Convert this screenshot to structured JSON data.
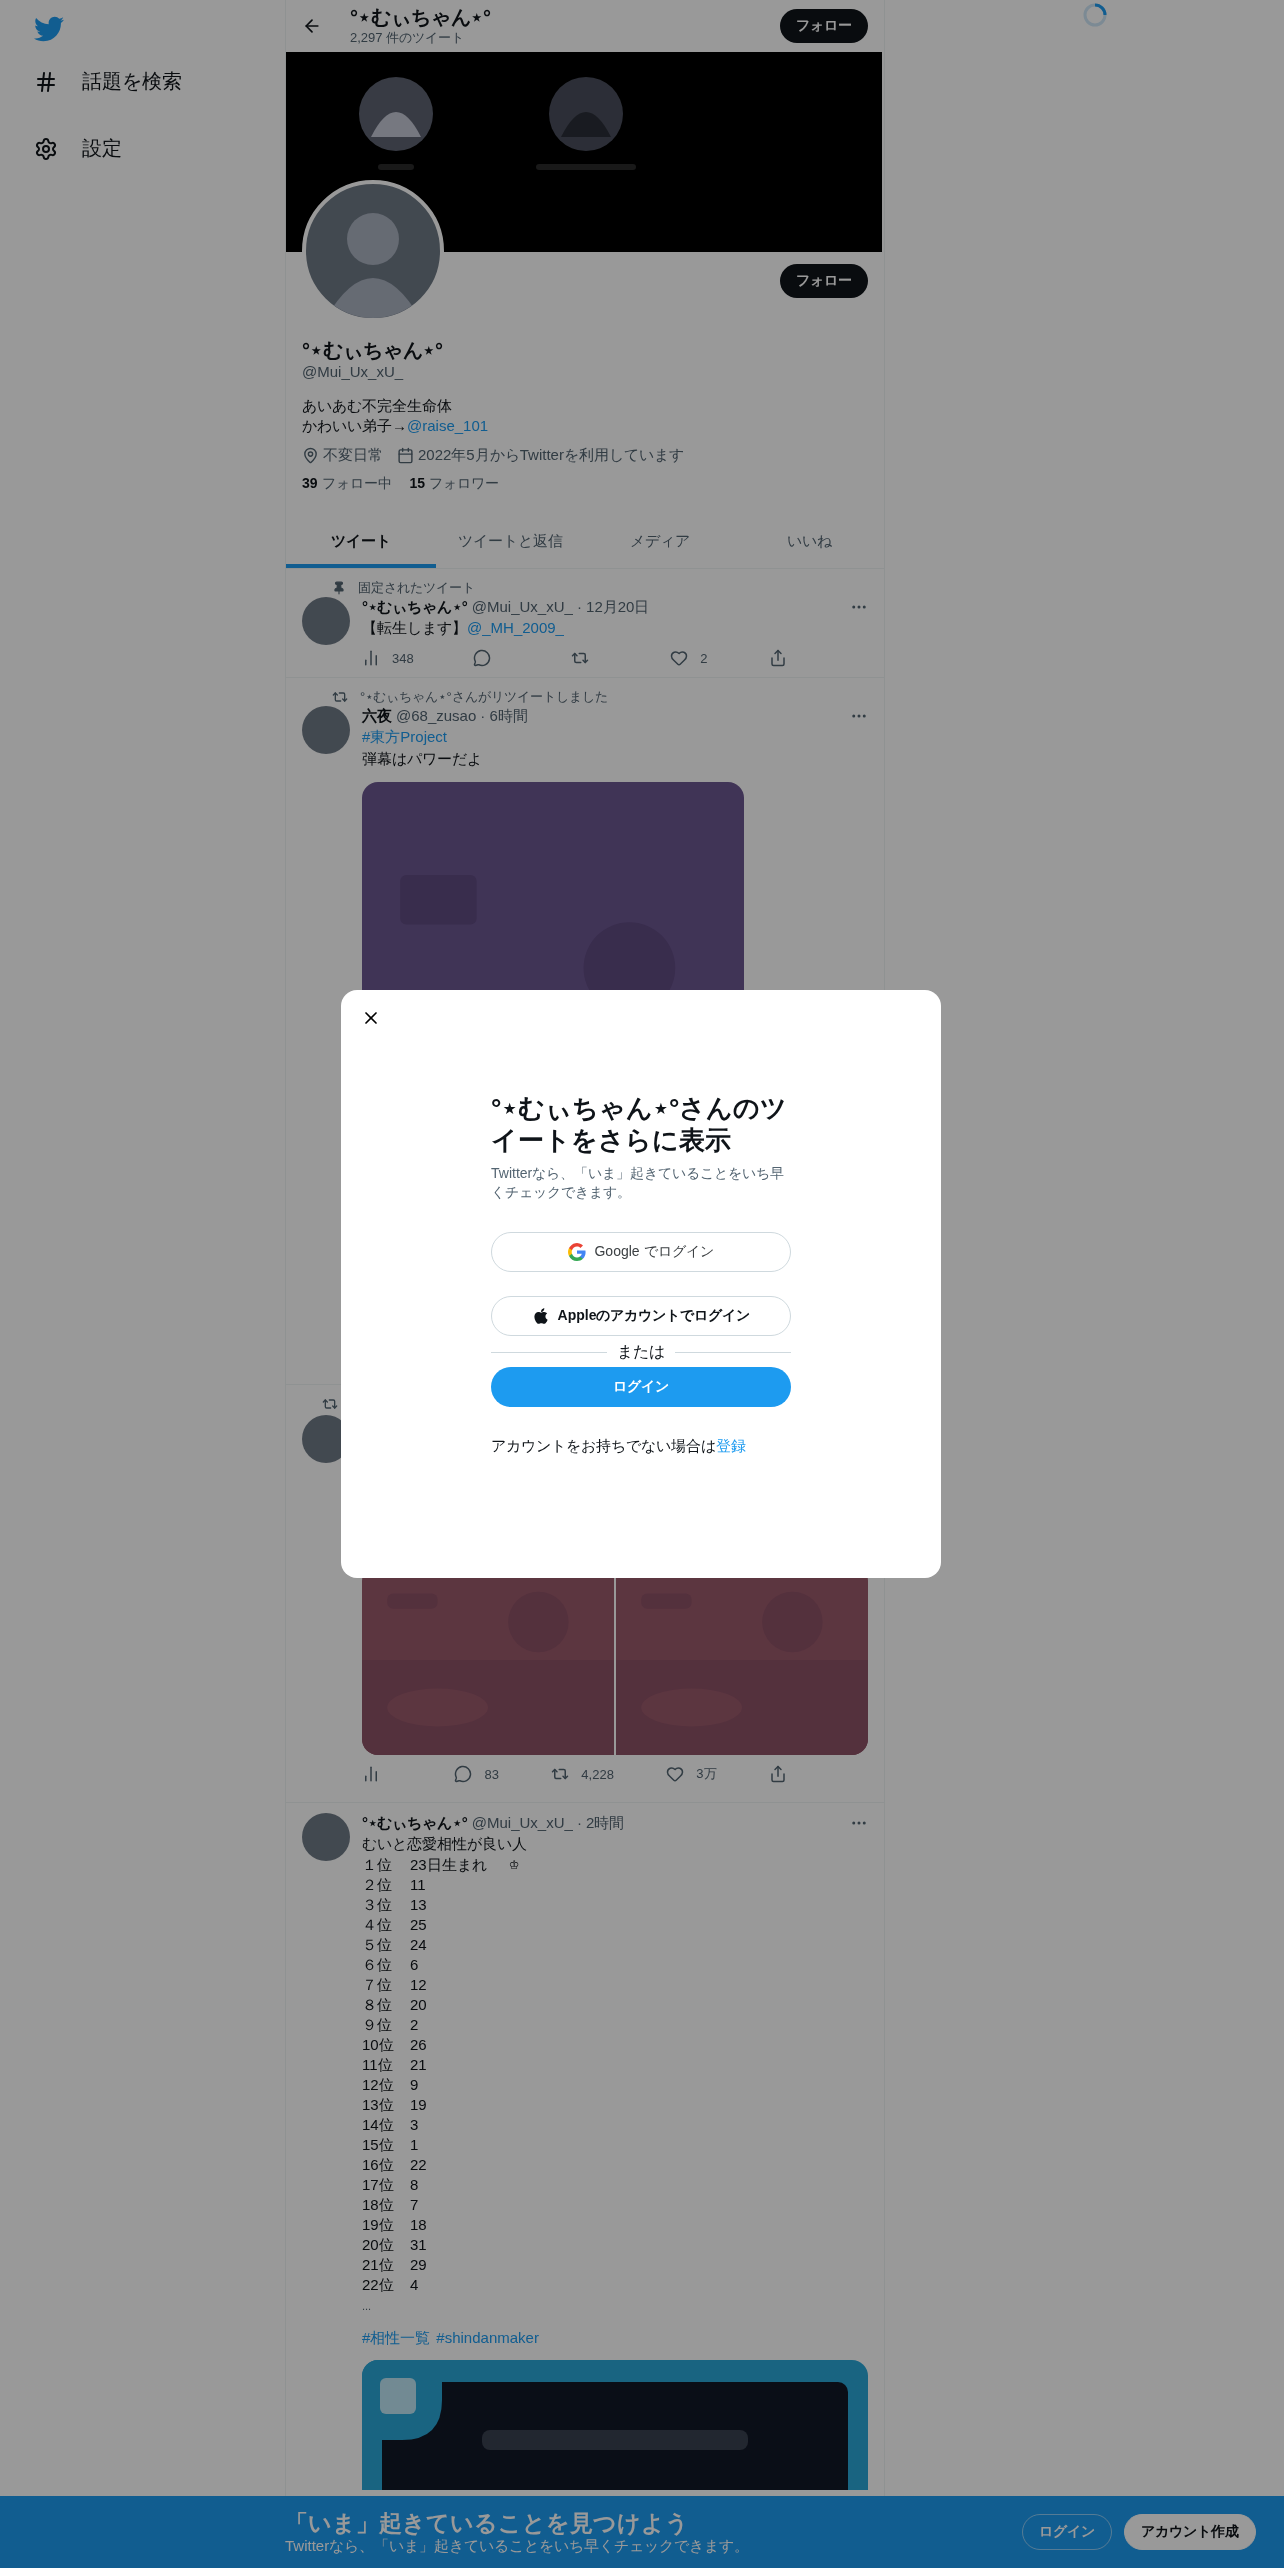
{
  "sidebar": {
    "items": [
      {
        "kind": "hashtag",
        "label": "話題を検索"
      },
      {
        "kind": "settings",
        "label": "設定"
      }
    ]
  },
  "header": {
    "name": "°⋆むぃちゃん⋆°",
    "tweet_count": "2,297 件のツイート",
    "follow_button": "フォロー"
  },
  "profile": {
    "follow_button": "フォロー",
    "name": "°⋆むぃちゃん⋆°",
    "handle": "@Mui_Ux_xU_",
    "bio_lines": [
      {
        "text": "あいあむ不完全生命体"
      },
      {
        "text": "かわいい弟子→",
        "mention": "@raise_101"
      }
    ],
    "location": "不変日常",
    "joined": "2022年5月からTwitterを利用しています",
    "following_count": "39",
    "following_label": "フォロー中",
    "followers_count": "15",
    "followers_label": "フォロワー"
  },
  "tabs": [
    {
      "label": "ツイート",
      "selected": true
    },
    {
      "label": "ツイートと返信",
      "selected": false
    },
    {
      "label": "メディア",
      "selected": false
    },
    {
      "label": "いいね",
      "selected": false
    }
  ],
  "tweets": [
    {
      "kind": "pinned",
      "context": "固定されたツイート",
      "name": "°⋆むぃちゃん⋆°",
      "handle": "@Mui_Ux_xU_",
      "time": "· 12月20日",
      "text": "【転生します】",
      "mention": "@_MH_2009_",
      "stats": {
        "views": "348",
        "likes": "2"
      }
    },
    {
      "kind": "retweet",
      "context": "°⋆むぃちゃん⋆°さんがリツイートしました",
      "name": "六夜",
      "handle": "@68_zusao",
      "time": "· 6時間",
      "hashtags": [
        "#東方Project"
      ],
      "text": "弾幕はパワーだよ",
      "media": {
        "kind": "single"
      }
    },
    {
      "kind": "retweet",
      "media": {
        "kind": "double"
      },
      "stats": {
        "replies": "83",
        "retweets": "4,228",
        "likes": "3万"
      }
    },
    {
      "kind": "original",
      "name": "°⋆むぃちゃん⋆°",
      "handle": "@Mui_Ux_xU_",
      "time": "· 2時間",
      "text": "むいと恋愛相性が良い人",
      "ranking": [
        {
          "rank": "１位",
          "value": "23日生まれ",
          "mark": "♔"
        },
        {
          "rank": "２位",
          "value": "11"
        },
        {
          "rank": "３位",
          "value": "13"
        },
        {
          "rank": "４位",
          "value": "25"
        },
        {
          "rank": "５位",
          "value": "24"
        },
        {
          "rank": "６位",
          "value": "6"
        },
        {
          "rank": "７位",
          "value": "12"
        },
        {
          "rank": "８位",
          "value": "20"
        },
        {
          "rank": "９位",
          "value": "2"
        },
        {
          "rank": "10位",
          "value": "26"
        },
        {
          "rank": "11位",
          "value": "21"
        },
        {
          "rank": "12位",
          "value": "9"
        },
        {
          "rank": "13位",
          "value": "19"
        },
        {
          "rank": "14位",
          "value": "3"
        },
        {
          "rank": "15位",
          "value": "1"
        },
        {
          "rank": "16位",
          "value": "22"
        },
        {
          "rank": "17位",
          "value": "8"
        },
        {
          "rank": "18位",
          "value": "7"
        },
        {
          "rank": "19位",
          "value": "18"
        },
        {
          "rank": "20位",
          "value": "31"
        },
        {
          "rank": "21位",
          "value": "29"
        },
        {
          "rank": "22位",
          "value": "4"
        }
      ],
      "ellipsis": "...",
      "hashtags": [
        "#相性一覧",
        "#shindanmaker"
      ],
      "media": {
        "kind": "card"
      }
    }
  ],
  "modal": {
    "title": "°⋆むぃちゃん⋆°さんのツイートをさらに表示",
    "subtitle": "Twitterなら、「いま」起きていることをいち早くチェックできます。",
    "google_button": "Google でログイン",
    "apple_button": "Appleのアカウントでログイン",
    "divider": "または",
    "login_button": "ログイン",
    "signup_text": "アカウントをお持ちでない場合は",
    "signup_link": "登録"
  },
  "bottom_bar": {
    "title": "「いま」起きていることを見つけよう",
    "subtitle": "Twitterなら、「いま」起きていることをいち早くチェックできます。",
    "login_button": "ログイン",
    "signup_button": "アカウント作成"
  }
}
